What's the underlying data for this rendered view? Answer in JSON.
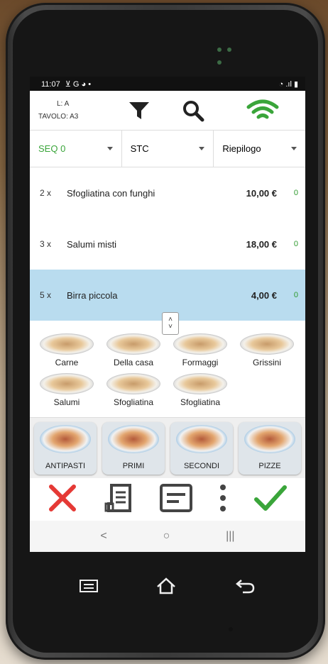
{
  "status_bar": {
    "time": "11:07",
    "left_icons": "⊻ G ◕ •",
    "right_icons": "◔ .ıl ▮"
  },
  "header": {
    "operator": "L: A",
    "table": "TAVOLO: A3",
    "filter_icon": "filter-icon",
    "search_icon": "search-icon",
    "wifi_icon": "wifi-icon"
  },
  "selectors": [
    {
      "label": "SEQ 0",
      "color": "#3aa53a"
    },
    {
      "label": "STC",
      "color": "#222222"
    },
    {
      "label": "Riepilogo",
      "color": "#222222"
    }
  ],
  "orders": [
    {
      "qty": "2 x",
      "name": "Sfogliatina con funghi",
      "price": "10,00 €",
      "count": "0",
      "selected": false
    },
    {
      "qty": "3 x",
      "name": "Salumi misti",
      "price": "18,00 €",
      "count": "0",
      "selected": false
    },
    {
      "qty": "5 x",
      "name": "Birra piccola",
      "price": "4,00 €",
      "count": "0",
      "selected": true
    }
  ],
  "toggle": {
    "up": "˄",
    "down": "˅"
  },
  "subcategories": [
    {
      "label": "Carne"
    },
    {
      "label": "Della casa"
    },
    {
      "label": "Formaggi"
    },
    {
      "label": "Grissini"
    },
    {
      "label": "Salumi"
    },
    {
      "label": "Sfogliatina"
    },
    {
      "label": "Sfogliatina"
    }
  ],
  "categories": [
    {
      "label": "ANTIPASTI"
    },
    {
      "label": "PRIMI"
    },
    {
      "label": "SECONDI"
    },
    {
      "label": "PIZZE"
    }
  ],
  "actions": {
    "cancel_icon": "close-icon",
    "receipt_icon": "receipt-icon",
    "note_icon": "note-icon",
    "more_icon": "more-vertical-icon",
    "confirm_icon": "check-icon"
  },
  "navbar": {
    "back": "<",
    "home": "○",
    "recents": "|||"
  },
  "colors": {
    "accent_green": "#3aa53a",
    "cancel_red": "#e53935",
    "selected_row": "#b9dcef"
  }
}
